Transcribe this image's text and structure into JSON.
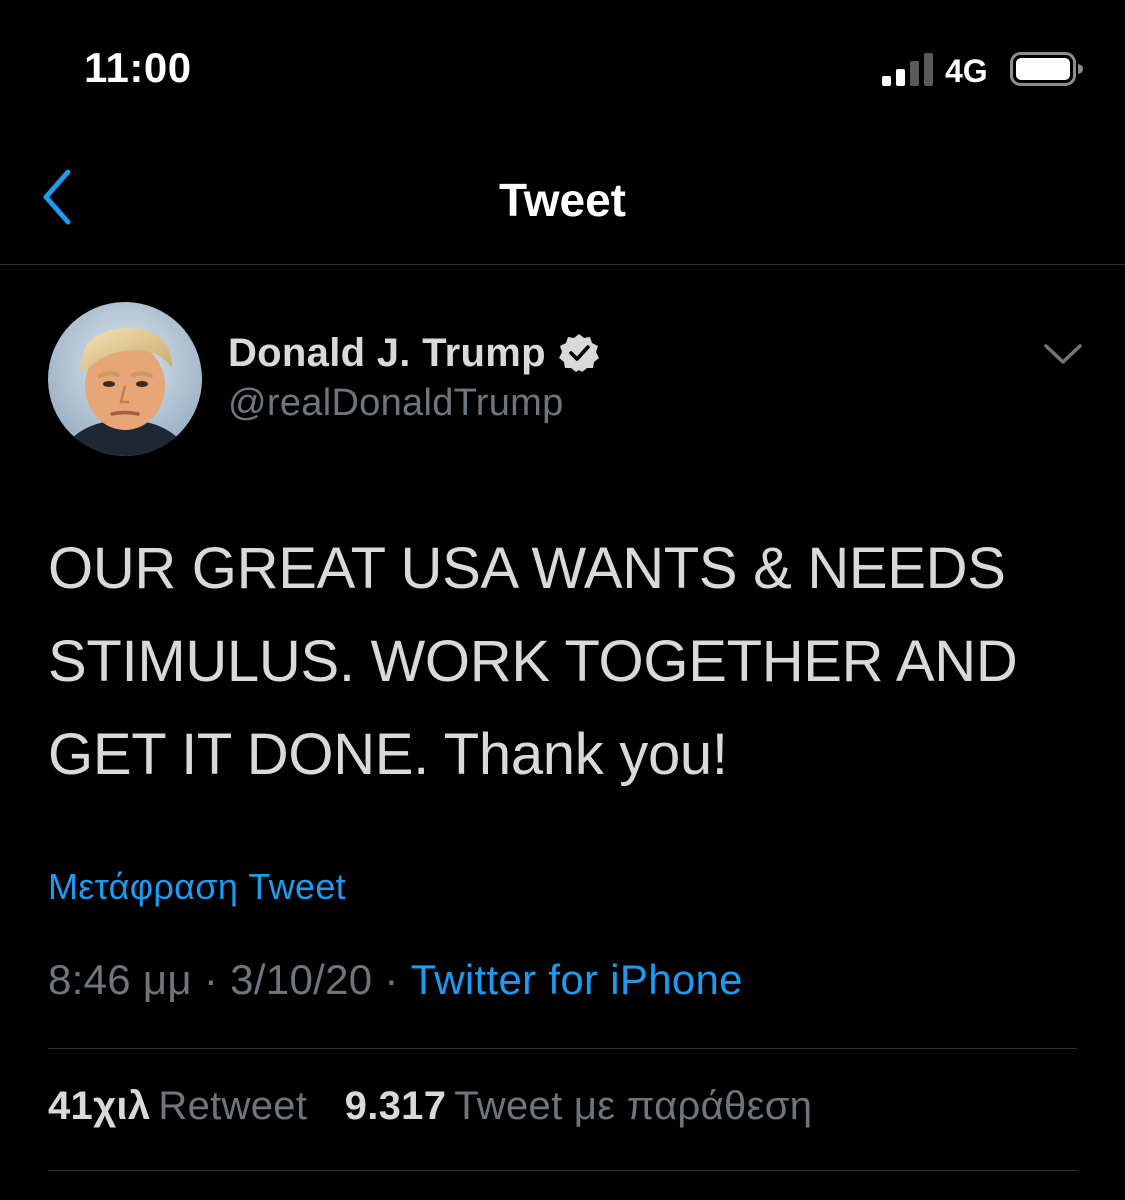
{
  "status_bar": {
    "time": "11:00",
    "network": "4G",
    "signal_bars_filled": 2,
    "signal_bars_total": 4
  },
  "nav": {
    "back_icon": "chevron-left-icon",
    "title": "Tweet"
  },
  "tweet": {
    "author": {
      "name": "Donald J. Trump",
      "handle": "@realDonaldTrump",
      "verified": true,
      "avatar_icon": "profile-photo"
    },
    "text": "OUR GREAT USA WANTS & NEEDS STIMULUS. WORK TOGETHER AND GET IT DONE. Thank you!",
    "translate_link": "Μετάφραση Tweet",
    "meta": {
      "time": "8:46 μμ",
      "separator": " · ",
      "date": "3/10/20",
      "source": "Twitter for iPhone"
    },
    "stats": [
      {
        "count": "41χιλ",
        "label": "Retweet"
      },
      {
        "count": "9.317",
        "label": "Tweet με παράθεση"
      }
    ]
  },
  "colors": {
    "background": "#000000",
    "primary_text": "#d9d9d9",
    "secondary_text": "#6e767d",
    "accent": "#1d9bf0",
    "divider": "#2f3336"
  }
}
